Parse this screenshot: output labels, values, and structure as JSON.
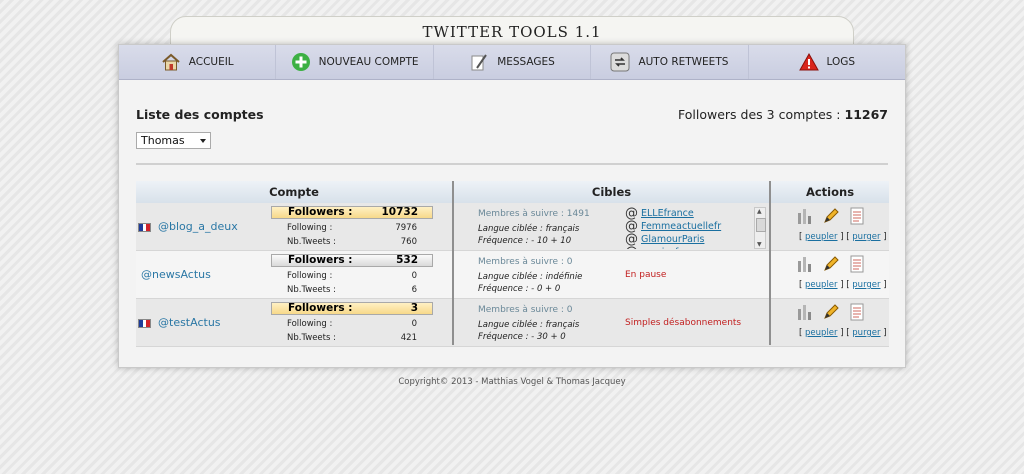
{
  "app": {
    "title": "TWITTER TOOLS 1.1"
  },
  "nav": [
    {
      "label": "ACCUEIL",
      "icon": "home-icon"
    },
    {
      "label": "NOUVEAU COMPTE",
      "icon": "add-icon"
    },
    {
      "label": "MESSAGES",
      "icon": "pen-icon"
    },
    {
      "label": "AUTO RETWEETS",
      "icon": "retweet-icon"
    },
    {
      "label": "LOGS",
      "icon": "warning-icon"
    }
  ],
  "header": {
    "list_title": "Liste des comptes",
    "followers_label": "Followers des 3 comptes :",
    "followers_total": "11267",
    "selected_account": "Thomas"
  },
  "table": {
    "col_account": "Compte",
    "col_targets": "Cibles",
    "col_actions": "Actions",
    "rows": [
      {
        "handle": "@blog_a_deux",
        "has_flag": true,
        "followers_label": "Followers :",
        "followers": "10732",
        "following_label": "Following :",
        "following": "7976",
        "tweets_label": "Nb.Tweets :",
        "tweets": "760",
        "members": "Membres à suivre : 1491",
        "language": "Langue ciblée : français",
        "frequency": "Fréquence : - 10 + 10",
        "targets": [
          "ELLEfrance",
          "Femmeactuellefr",
          "GlamourParis",
          "grazia_fr"
        ],
        "status": "",
        "link_peupler": "peupler",
        "link_purger": "purger"
      },
      {
        "handle": "@newsActus",
        "has_flag": false,
        "followers_label": "Followers :",
        "followers": "532",
        "following_label": "Following :",
        "following": "0",
        "tweets_label": "Nb.Tweets :",
        "tweets": "6",
        "members": "Membres à suivre : 0",
        "language": "Langue ciblée : indéfinie",
        "frequency": "Fréquence : - 0 + 0",
        "targets": [],
        "status": "En pause",
        "link_peupler": "peupler",
        "link_purger": "purger"
      },
      {
        "handle": "@testActus",
        "has_flag": true,
        "followers_label": "Followers :",
        "followers": "3",
        "following_label": "Following :",
        "following": "0",
        "tweets_label": "Nb.Tweets :",
        "tweets": "421",
        "members": "Membres à suivre : 0",
        "language": "Langue ciblée : français",
        "frequency": "Fréquence : - 30 + 0",
        "targets": [],
        "status": "Simples désabonnements",
        "link_peupler": "peupler",
        "link_purger": "purger"
      }
    ]
  },
  "footer": {
    "text": "Copyright© 2013 - Matthias Vogel & Thomas Jacquey"
  },
  "colors": {
    "accent": "#2a77a5",
    "status_red": "#c22020",
    "nav_bg": "#cfd3e5",
    "followers_gold": "#f7d98a"
  }
}
